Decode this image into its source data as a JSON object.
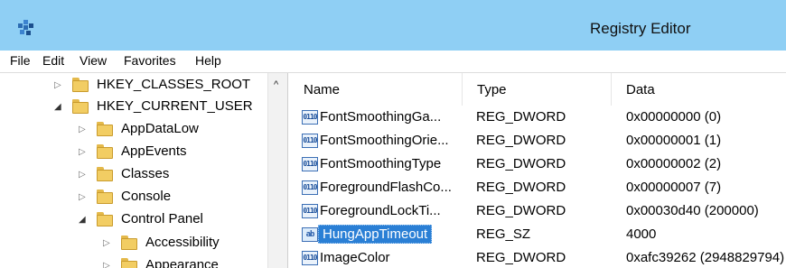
{
  "window": {
    "title": "Registry Editor",
    "icon": "registry-editor-icon"
  },
  "menu": [
    "File",
    "Edit",
    "View",
    "Favorites",
    "Help"
  ],
  "tree": {
    "scroll_up_glyph": "^",
    "items": [
      {
        "label": "HKEY_CLASSES_ROOT",
        "expanded": false
      },
      {
        "label": "HKEY_CURRENT_USER",
        "expanded": true
      },
      {
        "label": "AppDataLow",
        "expanded": false
      },
      {
        "label": "AppEvents",
        "expanded": false
      },
      {
        "label": "Classes",
        "expanded": false
      },
      {
        "label": "Console",
        "expanded": false
      },
      {
        "label": "Control Panel",
        "expanded": true
      },
      {
        "label": "Accessibility",
        "expanded": false
      },
      {
        "label": "Appearance",
        "expanded": false
      }
    ]
  },
  "list": {
    "columns": [
      "Name",
      "Type",
      "Data"
    ],
    "rows": [
      {
        "name": "FontSmoothingGa...",
        "type": "REG_DWORD",
        "data": "0x00000000 (0)",
        "icon": "dword-value-icon"
      },
      {
        "name": "FontSmoothingOrie...",
        "type": "REG_DWORD",
        "data": "0x00000001 (1)",
        "icon": "dword-value-icon"
      },
      {
        "name": "FontSmoothingType",
        "type": "REG_DWORD",
        "data": "0x00000002 (2)",
        "icon": "dword-value-icon"
      },
      {
        "name": "ForegroundFlashCo...",
        "type": "REG_DWORD",
        "data": "0x00000007 (7)",
        "icon": "dword-value-icon"
      },
      {
        "name": "ForegroundLockTi...",
        "type": "REG_DWORD",
        "data": "0x00030d40 (200000)",
        "icon": "dword-value-icon"
      },
      {
        "name": "HungAppTimeout",
        "type": "REG_SZ",
        "data": "4000",
        "icon": "string-value-icon",
        "selected": true
      },
      {
        "name": "ImageColor",
        "type": "REG_DWORD",
        "data": "0xafc39262 (2948829794)",
        "icon": "dword-value-icon"
      }
    ]
  },
  "icon_glyphs": {
    "dword": "0110",
    "string": "ab"
  },
  "colors": {
    "titlebar": "#8fcff4",
    "selection": "#2a7fd5",
    "folder": "#f2cd63"
  }
}
